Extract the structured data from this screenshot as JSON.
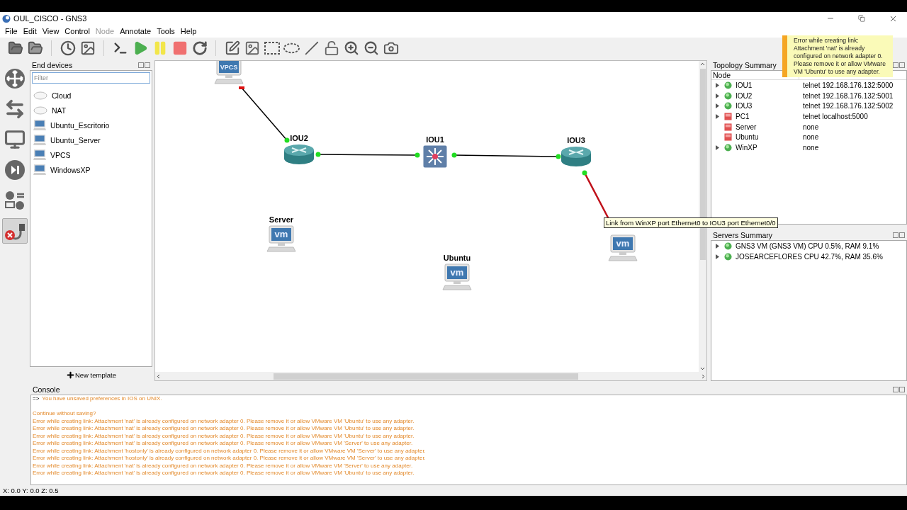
{
  "window": {
    "title": "OUL_CISCO - GNS3"
  },
  "menu": [
    {
      "label": "File",
      "disabled": false
    },
    {
      "label": "Edit",
      "disabled": false
    },
    {
      "label": "View",
      "disabled": false
    },
    {
      "label": "Control",
      "disabled": false
    },
    {
      "label": "Node",
      "disabled": true
    },
    {
      "label": "Annotate",
      "disabled": false
    },
    {
      "label": "Tools",
      "disabled": false
    },
    {
      "label": "Help",
      "disabled": false
    }
  ],
  "device_rail": [
    {
      "kind": "routers",
      "selected": false
    },
    {
      "kind": "switches",
      "selected": false
    },
    {
      "kind": "end-devices",
      "selected": false
    },
    {
      "kind": "security",
      "selected": false
    },
    {
      "kind": "all",
      "selected": false
    },
    {
      "kind": "add-link",
      "selected": true
    }
  ],
  "devices_panel": {
    "title": "End devices",
    "filter_placeholder": "Filter",
    "items": [
      {
        "kind": "cloud",
        "label": "Cloud"
      },
      {
        "kind": "cloud",
        "label": "NAT"
      },
      {
        "kind": "vm",
        "label": "Ubuntu_Escritorio"
      },
      {
        "kind": "vm",
        "label": "Ubuntu_Server"
      },
      {
        "kind": "vpcs",
        "label": "VPCS"
      },
      {
        "kind": "vm",
        "label": "WindowsXP"
      }
    ],
    "new_template": "New template"
  },
  "canvas": {
    "nodes": [
      {
        "kind": "vpcs",
        "screen_text": "VPCS"
      },
      {
        "kind": "router",
        "label": "IOU2"
      },
      {
        "kind": "switch",
        "label": "IOU1"
      },
      {
        "kind": "router",
        "label": "IOU3"
      },
      {
        "kind": "vm",
        "label": "Server",
        "screen_text": "vm"
      },
      {
        "kind": "vm",
        "label": "Ubuntu",
        "screen_text": "vm"
      },
      {
        "kind": "vm",
        "screen_text": "vm"
      }
    ],
    "links": [
      {
        "from_up": false,
        "to_up": true,
        "highlighted": false
      },
      {
        "from_up": true,
        "to_up": true,
        "highlighted": false
      },
      {
        "from_up": true,
        "to_up": true,
        "highlighted": false
      },
      {
        "from_up": true,
        "highlighted": true
      }
    ],
    "tooltip": "Link from WinXP port Ethernet0 to IOU3 port Ethernet0/0"
  },
  "notification": {
    "text": "Error while creating link: Attachment 'nat' is already configured on network adapter 0. Please remove it or allow VMware VM 'Ubuntu' to use any adapter."
  },
  "topology_summary": {
    "title": "Topology Summary",
    "columns": [
      "Node"
    ],
    "rows": [
      {
        "name": "IOU1",
        "console": "telnet 192.168.176.132:5000",
        "up": true,
        "expandable": true
      },
      {
        "name": "IOU2",
        "console": "telnet 192.168.176.132:5001",
        "up": true,
        "expandable": true
      },
      {
        "name": "IOU3",
        "console": "telnet 192.168.176.132:5002",
        "up": true,
        "expandable": true
      },
      {
        "name": "PC1",
        "console": "telnet localhost:5000",
        "up": false,
        "expandable": true
      },
      {
        "name": "Server",
        "console": "none",
        "up": false,
        "expandable": false
      },
      {
        "name": "Ubuntu",
        "console": "none",
        "up": false,
        "expandable": false
      },
      {
        "name": "WinXP",
        "console": "none",
        "up": true,
        "expandable": true
      }
    ]
  },
  "servers_summary": {
    "title": "Servers Summary",
    "rows": [
      {
        "text": "GNS3 VM (GNS3 VM) CPU 0.5%, RAM 9.1%",
        "up": true,
        "expandable": true
      },
      {
        "text": "JOSEARCEFLORES CPU 42.7%, RAM 35.6%",
        "up": true,
        "expandable": true
      }
    ]
  },
  "console": {
    "title": "Console",
    "lines": [
      {
        "kind": "prompt",
        "prompt": "=>",
        "text": "You have unsaved preferences in IOS on UNIX."
      },
      {
        "kind": "blank"
      },
      {
        "kind": "message",
        "text": "Continue without saving?"
      },
      {
        "kind": "message",
        "text": "Error while creating link: Attachment 'nat' is already configured on network adapter 0. Please remove it or allow VMware VM 'Ubuntu' to use any adapter."
      },
      {
        "kind": "message",
        "text": "Error while creating link: Attachment 'nat' is already configured on network adapter 0. Please remove it or allow VMware VM 'Ubuntu' to use any adapter."
      },
      {
        "kind": "message",
        "text": "Error while creating link: Attachment 'nat' is already configured on network adapter 0. Please remove it or allow VMware VM 'Ubuntu' to use any adapter."
      },
      {
        "kind": "message",
        "text": "Error while creating link: Attachment 'nat' is already configured on network adapter 0. Please remove it or allow VMware VM 'Server' to use any adapter."
      },
      {
        "kind": "message",
        "text": "Error while creating link: Attachment 'hostonly' is already configured on network adapter 0. Please remove it or allow VMware VM 'Server' to use any adapter."
      },
      {
        "kind": "message",
        "text": "Error while creating link: Attachment 'hostonly' is already configured on network adapter 0. Please remove it or allow VMware VM 'Server' to use any adapter."
      },
      {
        "kind": "message",
        "text": "Error while creating link: Attachment 'nat' is already configured on network adapter 0. Please remove it or allow VMware VM 'Server' to use any adapter."
      },
      {
        "kind": "message",
        "text": "Error while creating link: Attachment 'nat' is already configured on network adapter 0. Please remove it or allow VMware VM 'Ubuntu' to use any adapter."
      }
    ]
  },
  "status_bar": {
    "text": "X: 0.0 Y: 0.0 Z: 0.5"
  }
}
